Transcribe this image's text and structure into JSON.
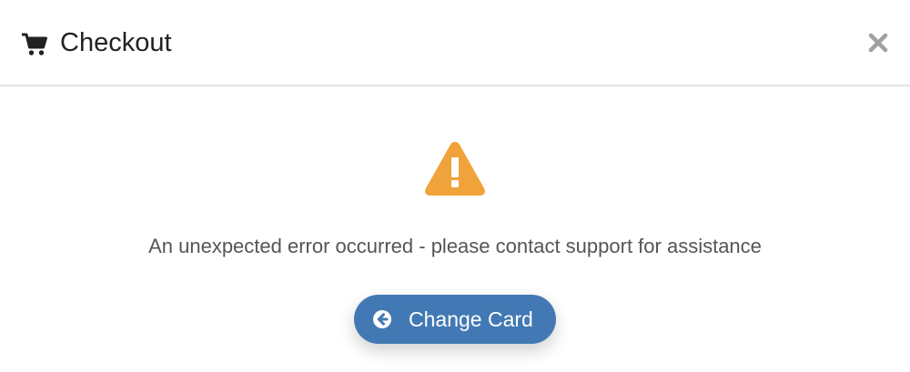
{
  "header": {
    "title": "Checkout",
    "icon": "shopping-cart-icon",
    "close_icon": "close-icon"
  },
  "body": {
    "status_icon": "warning-icon",
    "message": "An unexpected error occurred - please contact support for assistance"
  },
  "actions": {
    "change_card_label": "Change Card",
    "change_card_icon": "arrow-circle-left-icon"
  },
  "colors": {
    "title_text": "#222222",
    "message_text": "#555555",
    "warning": "#f0a33a",
    "primary_button": "#4279b4",
    "close": "#a0a0a0",
    "divider": "#e3e3e3"
  }
}
